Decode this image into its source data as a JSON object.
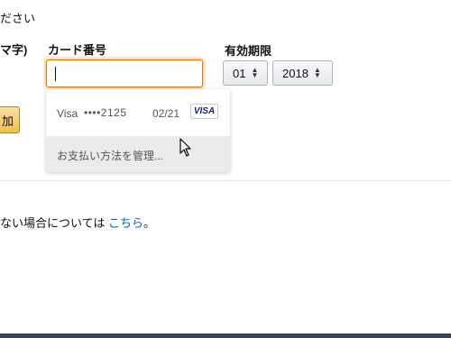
{
  "header": {
    "instruction_fragment": "ださい"
  },
  "form": {
    "name_label_fragment": "マ字)",
    "card_label": "カード番号",
    "expiry_label": "有効期限",
    "card_number_value": "",
    "expiry_month": "01",
    "expiry_year": "2018",
    "add_button_label_fragment": "加"
  },
  "autofill": {
    "card": {
      "brand": "Visa",
      "masked_number": "••••2125",
      "expiry": "02/21",
      "badge_text": "VISA"
    },
    "manage_label": "お支払い方法を管理..."
  },
  "footer": {
    "text_fragment": "ない場合については",
    "link_text": "こちら",
    "suffix": "。"
  },
  "colors": {
    "focus_border": "#e77600",
    "link": "#0066c0",
    "button_yellow": "#f0c14b",
    "footer_bar": "#37475a",
    "visa_blue": "#1a1f71"
  }
}
